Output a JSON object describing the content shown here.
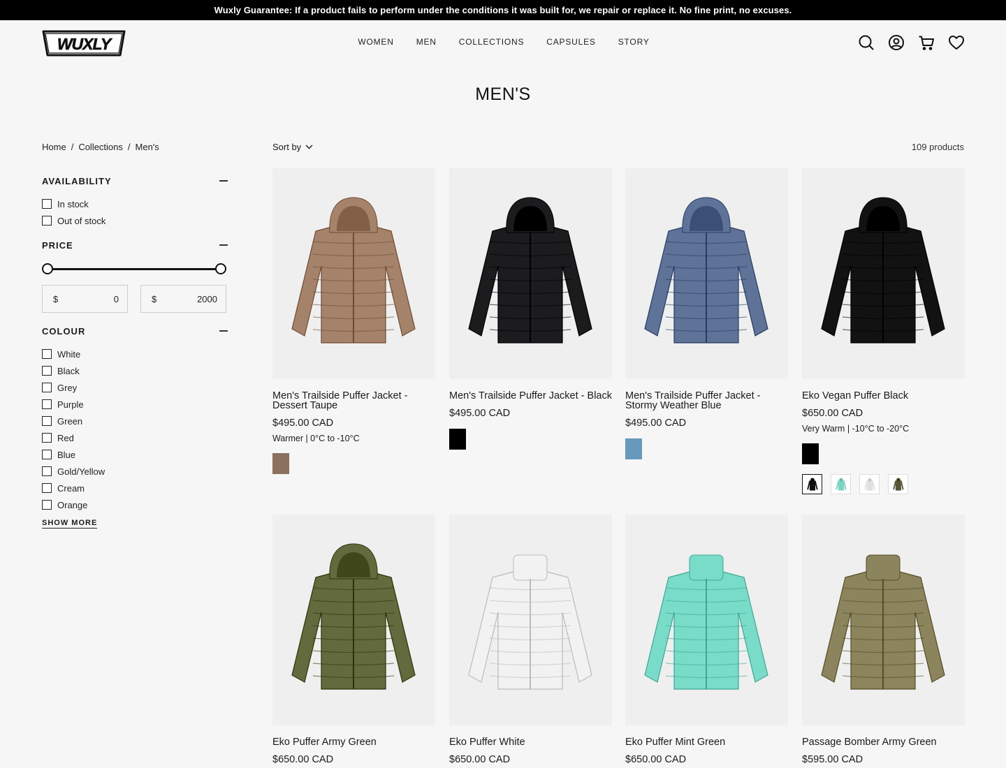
{
  "announcement": "Wuxly Guarantee: If a product fails to perform under the conditions it was built for, we repair or replace it. No fine print, no excuses.",
  "logo_text": "WUXLY",
  "nav": [
    "WOMEN",
    "MEN",
    "COLLECTIONS",
    "CAPSULES",
    "STORY"
  ],
  "header_icons": [
    "search-icon",
    "account-icon",
    "cart-icon",
    "wishlist-icon"
  ],
  "page_title": "MEN'S",
  "breadcrumb": [
    "Home",
    "Collections",
    "Men's"
  ],
  "breadcrumb_sep": "/",
  "sort_label": "Sort by",
  "product_count": "109 products",
  "filters": {
    "availability": {
      "title": "AVAILABILITY",
      "options": [
        "In stock",
        "Out of stock"
      ]
    },
    "price": {
      "title": "PRICE",
      "currency": "$",
      "min": "0",
      "max": "2000",
      "range_low": 0,
      "range_high": 1
    },
    "colour": {
      "title": "COLOUR",
      "options": [
        "White",
        "Black",
        "Grey",
        "Purple",
        "Green",
        "Red",
        "Blue",
        "Gold/Yellow",
        "Cream",
        "Orange"
      ],
      "show_more": "SHOW MORE"
    }
  },
  "products": [
    {
      "name": "Men's Trailside Puffer Jacket - Dessert Taupe",
      "price": "$495.00 CAD",
      "temp": "Warmer | 0°C to -10°C",
      "color": "#a4836a",
      "swatches": [
        "#8c705f"
      ]
    },
    {
      "name": "Men's Trailside Puffer Jacket - Black",
      "price": "$495.00 CAD",
      "temp": "",
      "color": "#1c1c1e",
      "swatches": [
        "#000000"
      ]
    },
    {
      "name": "Men's Trailside Puffer Jacket - Stormy Weather Blue",
      "price": "$495.00 CAD",
      "temp": "",
      "color": "#5f7399",
      "swatches": [
        "#6699bb"
      ]
    },
    {
      "name": "Eko Vegan Puffer Black",
      "price": "$650.00 CAD",
      "temp": "Very Warm | -10°C to -20°C",
      "color": "#121212",
      "swatches": [
        "#000000"
      ],
      "thumbs": [
        "#121212",
        "#7fd9c8",
        "#e4e4e4",
        "#5e5a3c"
      ]
    },
    {
      "name": "Eko Puffer Army Green",
      "price": "$650.00 CAD",
      "temp": "",
      "color": "#636a3e"
    },
    {
      "name": "Eko Puffer White",
      "price": "$650.00 CAD",
      "temp": "",
      "color": "#f2f2f2"
    },
    {
      "name": "Eko Puffer Mint Green",
      "price": "$650.00 CAD",
      "temp": "",
      "color": "#79dcc9"
    },
    {
      "name": "Passage Bomber Army Green",
      "price": "$595.00 CAD",
      "temp": "",
      "color": "#8b845c"
    }
  ]
}
